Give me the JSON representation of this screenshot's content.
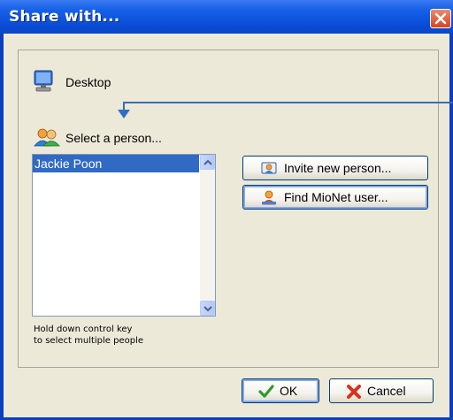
{
  "window": {
    "title": "Share with..."
  },
  "location": {
    "label": "Desktop",
    "icon": "monitor-icon"
  },
  "people": {
    "label": "Select a person...",
    "icon": "people-icon",
    "items": [
      "Jackie Poon"
    ],
    "selected_index": 0,
    "hint_line1": "Hold down control key",
    "hint_line2": "to select multiple people"
  },
  "actions": {
    "invite_label": "Invite new person...",
    "find_label": "Find MioNet user..."
  },
  "footer": {
    "ok_label": "OK",
    "cancel_label": "Cancel"
  },
  "colors": {
    "titlebar": "#0a4cd6",
    "selection": "#316ac5",
    "dialog_bg": "#ece9d8",
    "annotation_arrow": "#2f6fc0"
  }
}
